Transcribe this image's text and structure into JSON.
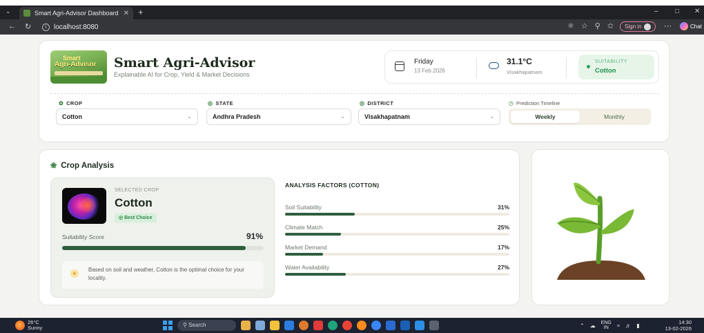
{
  "browser": {
    "tab_title": "Smart Agri-Advisor Dashboard",
    "url": "localhost:8080",
    "sign_in": "Sign in",
    "chat": "Chat"
  },
  "header": {
    "title": "Smart Agri-Advisor",
    "subtitle": "Explainable AI for Crop, Yield & Market Decisions",
    "logo_top": "Smart",
    "logo_main": "Agri-Advisor",
    "day": "Friday",
    "date": "13 Feb 2026",
    "temperature": "31.1°C",
    "location": "Visakhapatnam",
    "suitability_label": "SUITABILITY",
    "suitability_value": "Cotton"
  },
  "filters": {
    "crop_label": "CROP",
    "crop_value": "Cotton",
    "state_label": "STATE",
    "state_value": "Andhra Pradesh",
    "district_label": "DISTRICT",
    "district_value": "Visakhapatnam",
    "timeline_label": "Prediction Timeline",
    "timeline_options": [
      "Weekly",
      "Monthly"
    ]
  },
  "analysis": {
    "section_title": "Crop Analysis",
    "selected_label": "SELECTED CROP",
    "crop_name": "Cotton",
    "badge": "Best Choice",
    "score_label": "Suitability Score",
    "score_value": "91%",
    "score_fraction": 0.91,
    "note": "Based on soil and weather, Cotton is the optimal choice for your locality.",
    "factors_title": "ANALYSIS FACTORS (COTTON)",
    "factors": [
      {
        "name": "Soil Suitability",
        "value": "31%",
        "fraction": 0.31
      },
      {
        "name": "Climate Match",
        "value": "25%",
        "fraction": 0.25
      },
      {
        "name": "Market Demand",
        "value": "17%",
        "fraction": 0.17
      },
      {
        "name": "Water Availability",
        "value": "27%",
        "fraction": 0.27
      }
    ]
  },
  "taskbar": {
    "weather_temp": "26°C",
    "weather_desc": "Sunny",
    "search": "Search",
    "lang_top": "ENG",
    "lang_bottom": "IN",
    "time": "14:30",
    "date": "13-02-2026"
  },
  "colors": {
    "accent_green": "#2f5e3e",
    "suitability_bg": "#e6f5e8",
    "suitability_text": "#1f8f4f"
  }
}
